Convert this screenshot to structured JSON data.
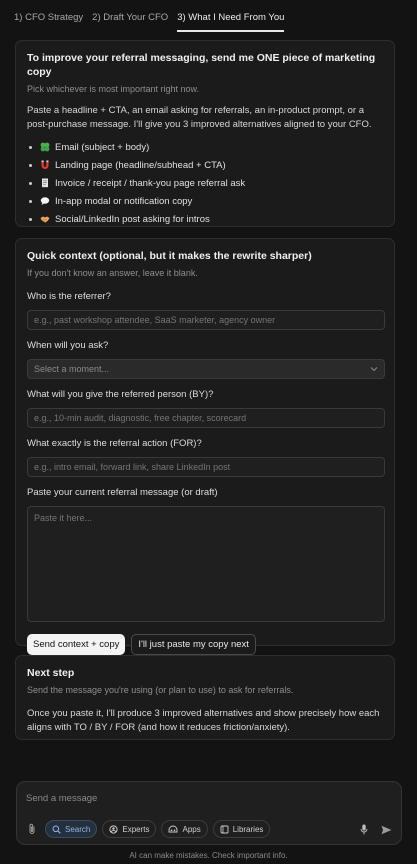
{
  "tabs": [
    {
      "label": "1) CFO Strategy"
    },
    {
      "label": "2) Draft Your CFO"
    },
    {
      "label": "3) What I Need From You"
    }
  ],
  "card1": {
    "title": "To improve your referral messaging, send me ONE piece of marketing copy",
    "subtitle": "Pick whichever is most important right now.",
    "paragraph": "Paste a headline + CTA, an email asking for referrals, an in-product prompt, or a post-purchase message. I'll give you 3 improved alternatives aligned to your CFO.",
    "items": [
      {
        "label": "Email (subject + body)",
        "icon": "four-leaf-clover-icon",
        "color": "#4caf50"
      },
      {
        "label": "Landing page (headline/subhead + CTA)",
        "icon": "magnet-icon",
        "color": "#e53935"
      },
      {
        "label": "Invoice / receipt / thank-you page referral ask",
        "icon": "receipt-icon",
        "color": "#e0e0e0"
      },
      {
        "label": "In-app modal or notification copy",
        "icon": "speech-bubble-icon",
        "color": "#f5f5f5"
      },
      {
        "label": "Social/LinkedIn post asking for intros",
        "icon": "handshake-icon",
        "color": "#f2a65a"
      }
    ]
  },
  "card2": {
    "title": "Quick context (optional, but it makes the rewrite sharper)",
    "subtitle": "If you don't know an answer, leave it blank.",
    "fields": {
      "referrer": {
        "label": "Who is the referrer?",
        "placeholder": "e.g., past workshop attendee, SaaS marketer, agency owner",
        "value": ""
      },
      "when": {
        "label": "When will you ask?",
        "selected": "Select a moment..."
      },
      "by": {
        "label": "What will you give the referred person (BY)?",
        "placeholder": "e.g., 10-min audit, diagnostic, free chapter, scorecard",
        "value": ""
      },
      "for": {
        "label": "What exactly is the referral action (FOR)?",
        "placeholder": "e.g., intro email, forward link, share LinkedIn post",
        "value": ""
      },
      "message": {
        "label": "Paste your current referral message (or draft)",
        "placeholder": "Paste it here...",
        "value": ""
      }
    },
    "send_button": "Send context + copy",
    "paste_button": "I'll just paste my copy next"
  },
  "card3": {
    "title": "Next step",
    "subtitle": "Send the message you're using (or plan to use) to ask for referrals.",
    "paragraph": "Once you paste it, I'll produce 3 improved alternatives and show precisely how each aligns with TO / BY / FOR (and how it reduces friction/anxiety)."
  },
  "composer": {
    "placeholder": "Send a message",
    "tools": [
      {
        "label": "Search",
        "icon": "globe-search-icon"
      },
      {
        "label": "Experts",
        "icon": "experts-icon"
      },
      {
        "label": "Apps",
        "icon": "apps-icon"
      },
      {
        "label": "Libraries",
        "icon": "library-icon"
      }
    ]
  },
  "footer": {
    "note": "AI can make mistakes. Check important info."
  },
  "colors": {
    "background": "#131313",
    "card": "#1b1b1b",
    "accent": "#8fb6e3"
  }
}
